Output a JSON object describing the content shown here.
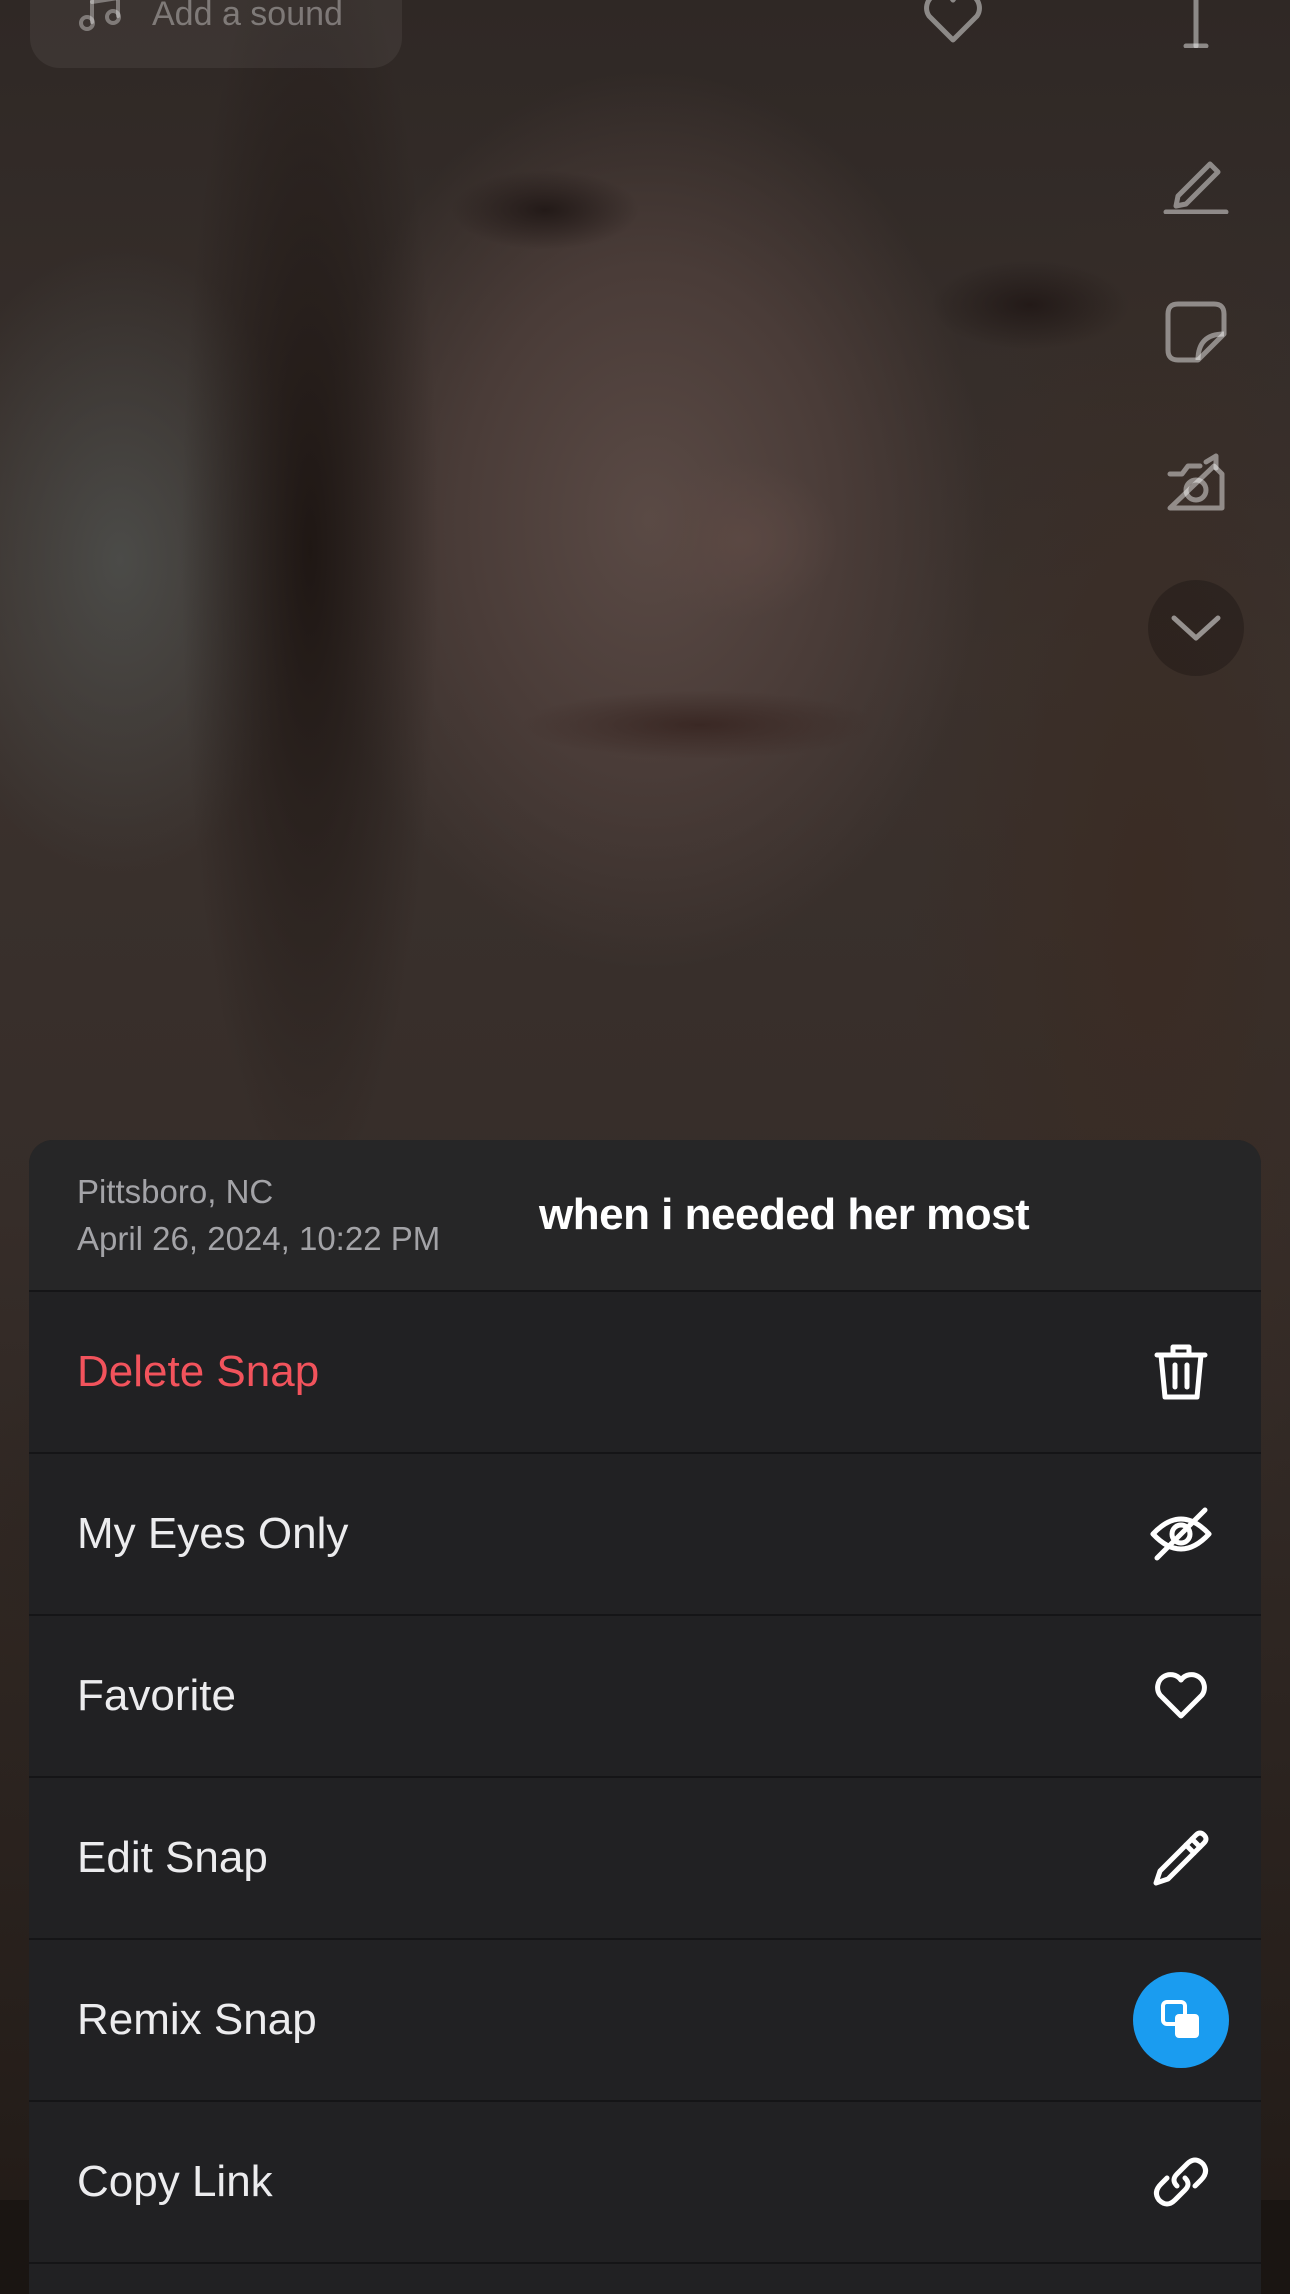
{
  "top_bar": {
    "sound_label": "Add a sound"
  },
  "side_tools": [
    "text-icon",
    "pencil-icon",
    "sticker-icon",
    "camera-flip-icon",
    "chevron-down-icon"
  ],
  "sheet": {
    "location": "Pittsboro, NC",
    "date": "April 26, 2024, 10:22 PM",
    "caption": "when i needed her most",
    "items": [
      {
        "label": "Delete Snap",
        "icon": "trash-icon",
        "destructive": true
      },
      {
        "label": "My Eyes Only",
        "icon": "eye-slash-icon"
      },
      {
        "label": "Favorite",
        "icon": "heart-icon"
      },
      {
        "label": "Edit Snap",
        "icon": "pencil-icon"
      },
      {
        "label": "Remix Snap",
        "icon": "remix-icon"
      },
      {
        "label": "Copy Link",
        "icon": "link-icon"
      }
    ]
  },
  "colors": {
    "sheet_background": "#212123",
    "destructive": "#f2535c",
    "remix_accent": "#1a9cf0"
  }
}
